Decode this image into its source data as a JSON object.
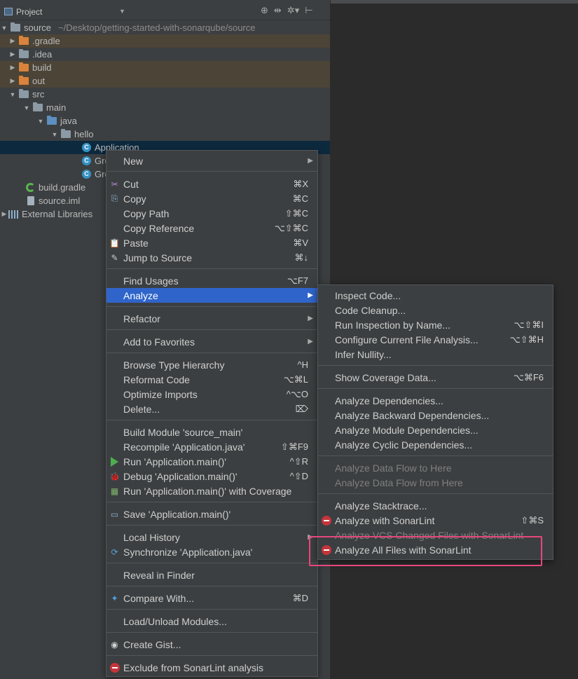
{
  "panel": {
    "title": "Project",
    "tools": [
      "⊕",
      "⇹",
      "✲▾",
      "⊢"
    ]
  },
  "tree": [
    {
      "label": "source",
      "hint": "~/Desktop/getting-started-with-sonarqube/source"
    },
    {
      "label": ".gradle"
    },
    {
      "label": ".idea"
    },
    {
      "label": "build"
    },
    {
      "label": "out"
    },
    {
      "label": "src"
    },
    {
      "label": "main"
    },
    {
      "label": "java"
    },
    {
      "label": "hello"
    },
    {
      "label": "Application"
    },
    {
      "label": "Gre"
    },
    {
      "label": "Gre"
    },
    {
      "label": "build.gradle"
    },
    {
      "label": "source.iml"
    },
    {
      "label": "External Libraries"
    }
  ],
  "context_menu": [
    {
      "label": "New",
      "shortcut": "",
      "arrow": "▶"
    },
    {
      "label": "Cut",
      "shortcut": "⌘X",
      "icon": "✂"
    },
    {
      "label": "Copy",
      "shortcut": "⌘C",
      "icon": "⎘"
    },
    {
      "label": "Copy Path",
      "shortcut": "⇧⌘C"
    },
    {
      "label": "Copy Reference",
      "shortcut": "⌥⇧⌘C"
    },
    {
      "label": "Paste",
      "shortcut": "⌘V",
      "icon": "📋"
    },
    {
      "label": "Jump to Source",
      "shortcut": "⌘↓",
      "icon": "✎"
    },
    {
      "label": "Find Usages",
      "shortcut": "⌥F7"
    },
    {
      "label": "Analyze",
      "shortcut": "",
      "arrow": "▶"
    },
    {
      "label": "Refactor",
      "shortcut": "",
      "arrow": "▶"
    },
    {
      "label": "Add to Favorites",
      "shortcut": "",
      "arrow": "▶"
    },
    {
      "label": "Browse Type Hierarchy",
      "shortcut": "^H"
    },
    {
      "label": "Reformat Code",
      "shortcut": "⌥⌘L"
    },
    {
      "label": "Optimize Imports",
      "shortcut": "^⌥O"
    },
    {
      "label": "Delete...",
      "shortcut": "⌦"
    },
    {
      "label": "Build Module 'source_main'",
      "shortcut": ""
    },
    {
      "label": "Recompile 'Application.java'",
      "shortcut": "⇧⌘F9"
    },
    {
      "label": "Run 'Application.main()'",
      "shortcut": "^⇧R"
    },
    {
      "label": "Debug 'Application.main()'",
      "shortcut": "^⇧D",
      "icon": "🐞"
    },
    {
      "label": "Run 'Application.main()' with Coverage",
      "shortcut": "",
      "icon": "▦"
    },
    {
      "label": "Save 'Application.main()'",
      "shortcut": "",
      "icon": "▭"
    },
    {
      "label": "Local History",
      "shortcut": "",
      "arrow": "▶"
    },
    {
      "label": "Synchronize 'Application.java'",
      "shortcut": "",
      "icon": "⟳"
    },
    {
      "label": "Reveal in Finder",
      "shortcut": ""
    },
    {
      "label": "Compare With...",
      "shortcut": "⌘D",
      "icon": "✦"
    },
    {
      "label": "Load/Unload Modules...",
      "shortcut": ""
    },
    {
      "label": "Create Gist...",
      "shortcut": "",
      "icon": "◉"
    },
    {
      "label": "Exclude from SonarLint analysis",
      "shortcut": ""
    }
  ],
  "analyze_submenu": [
    {
      "label": "Inspect Code...",
      "shortcut": ""
    },
    {
      "label": "Code Cleanup...",
      "shortcut": ""
    },
    {
      "label": "Run Inspection by Name...",
      "shortcut": "⌥⇧⌘I"
    },
    {
      "label": "Configure Current File Analysis...",
      "shortcut": "⌥⇧⌘H"
    },
    {
      "label": "Infer Nullity...",
      "shortcut": ""
    },
    {
      "label": "Show Coverage Data...",
      "shortcut": "⌥⌘F6"
    },
    {
      "label": "Analyze Dependencies...",
      "shortcut": ""
    },
    {
      "label": "Analyze Backward Dependencies...",
      "shortcut": ""
    },
    {
      "label": "Analyze Module Dependencies...",
      "shortcut": ""
    },
    {
      "label": "Analyze Cyclic Dependencies...",
      "shortcut": ""
    },
    {
      "label": "Analyze Data Flow to Here",
      "shortcut": ""
    },
    {
      "label": "Analyze Data Flow from Here",
      "shortcut": ""
    },
    {
      "label": "Analyze Stacktrace...",
      "shortcut": ""
    },
    {
      "label": "Analyze with SonarLint",
      "shortcut": "⇧⌘S"
    },
    {
      "label": "Analyze VCS Changed Files with SonarLint",
      "shortcut": ""
    },
    {
      "label": "Analyze All Files with SonarLint",
      "shortcut": ""
    }
  ],
  "colors": {
    "accent": "#2f65ca",
    "highlight": "#e7467b",
    "sonarlint": "#c4353b"
  }
}
